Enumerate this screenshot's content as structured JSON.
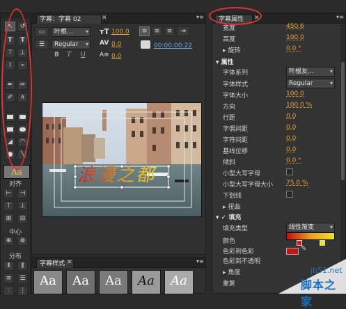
{
  "left_toolbar": {
    "align_label": "对齐",
    "center_label": "中心",
    "distribute_label": "分布",
    "style_preview_text": "Aa"
  },
  "title_panel": {
    "tab_label": "字幕：字幕 02",
    "font_family": "叶根...",
    "font_style": "Regular",
    "font_size": "100.0",
    "kerning": "0.0",
    "leading": "0.0",
    "timecode": "00:00:00:22",
    "canvas_text": "浪漫之都"
  },
  "styles_panel": {
    "tab_label": "字幕样式",
    "swatches": [
      "Aa",
      "Aa",
      "Aa",
      "Aa",
      "Aa"
    ]
  },
  "properties_panel": {
    "tab_label": "字幕属性",
    "rows": {
      "width": {
        "label": "宽度",
        "value": "450.6"
      },
      "height": {
        "label": "高度",
        "value": "100.0"
      },
      "rotation": {
        "label": "旋转",
        "value": "0.0 °"
      },
      "section_props": {
        "label": "属性"
      },
      "font_family": {
        "label": "字体系列",
        "value": "叶根友..."
      },
      "font_style": {
        "label": "字体样式",
        "value": "Regular"
      },
      "font_size": {
        "label": "字体大小",
        "value": "100.0"
      },
      "aspect": {
        "label": "方向",
        "value": "100.0 %"
      },
      "leading": {
        "label": "行距",
        "value": "0.0"
      },
      "kerning": {
        "label": "字偶间距",
        "value": "0.0"
      },
      "tracking": {
        "label": "字符间距",
        "value": "0.0"
      },
      "baseline": {
        "label": "基线位移",
        "value": "0.0"
      },
      "slant": {
        "label": "倾斜",
        "value": "0.0 °"
      },
      "small_caps": {
        "label": "小型大写字母"
      },
      "small_caps_size": {
        "label": "小型大写字母大小",
        "value": "75.0 %"
      },
      "underline": {
        "label": "下划线"
      },
      "distort": {
        "label": "扭曲"
      },
      "fill": {
        "label": "填充"
      },
      "fill_type": {
        "label": "填充类型",
        "value": "线性渐变"
      },
      "color": {
        "label": "颜色"
      },
      "color_to_color": {
        "label": "色彩到色彩"
      },
      "color_to_opacity": {
        "label": "色彩到不透明"
      },
      "angle": {
        "label": "角度"
      },
      "repeat": {
        "label": "重复"
      }
    }
  },
  "watermark": {
    "site": "jb51.net",
    "name": "脚本之家"
  },
  "colors": {
    "accent": "#e8a33c",
    "annotation_red": "#e23333"
  }
}
